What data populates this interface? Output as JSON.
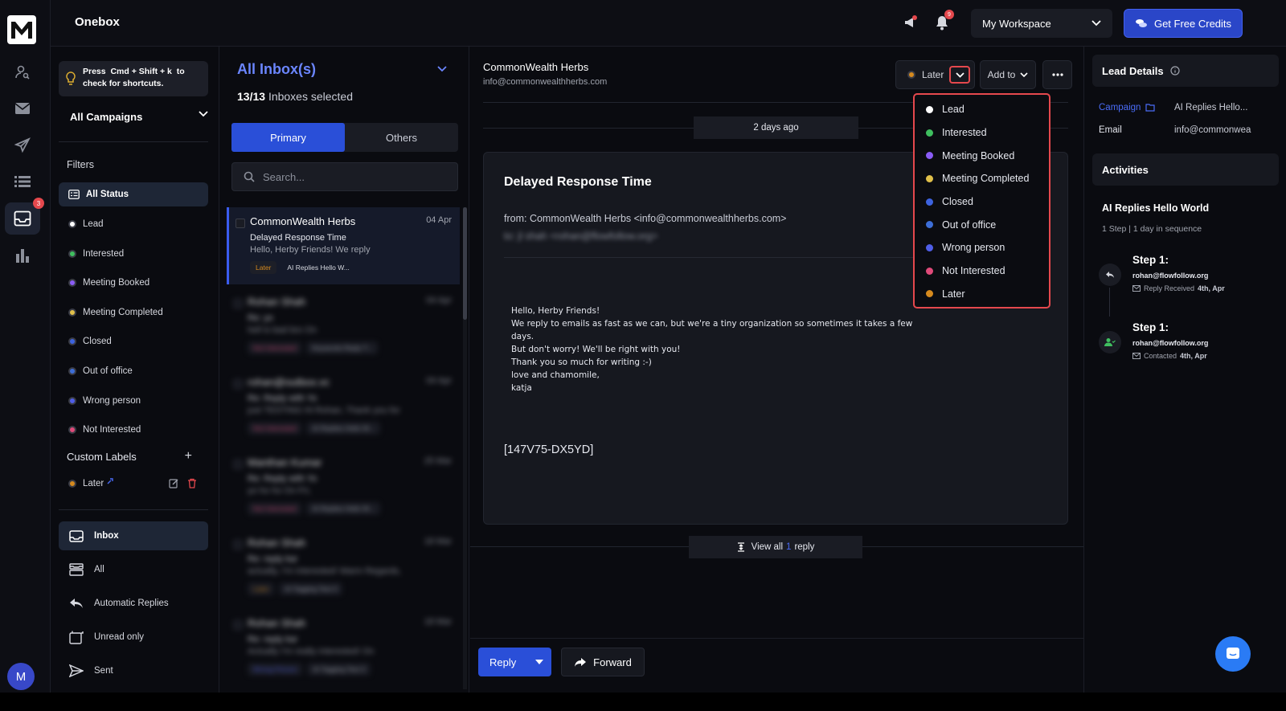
{
  "header": {
    "title": "Onebox",
    "bell_count": "9",
    "workspace": "My Workspace",
    "credits_label": "Get Free Credits"
  },
  "rail": {
    "inbox_badge": "3",
    "avatar_letter": "M"
  },
  "sidebar": {
    "tip_prefix": "Press",
    "tip_keys": "Cmd + Shift + k",
    "tip_suffix": "to check for shortcuts.",
    "campaign_select": "All Campaigns",
    "filters_label": "Filters",
    "statuses": [
      {
        "label": "All Status",
        "color": ""
      },
      {
        "label": "Lead",
        "color": "#ffffff"
      },
      {
        "label": "Interested",
        "color": "#3fbf5f"
      },
      {
        "label": "Meeting Booked",
        "color": "#8a5cf6"
      },
      {
        "label": "Meeting Completed",
        "color": "#e0c04a"
      },
      {
        "label": "Closed",
        "color": "#3d63e0"
      },
      {
        "label": "Out of office",
        "color": "#3d6ed8"
      },
      {
        "label": "Wrong person",
        "color": "#4f5ee8"
      },
      {
        "label": "Not Interested",
        "color": "#e04a7a"
      }
    ],
    "custom_labels_heading": "Custom Labels",
    "custom_label": {
      "label": "Later",
      "color": "#d68a1e"
    },
    "nav": [
      {
        "label": "Inbox"
      },
      {
        "label": "All"
      },
      {
        "label": "Automatic Replies"
      },
      {
        "label": "Unread only"
      },
      {
        "label": "Sent"
      }
    ]
  },
  "inbox": {
    "title": "All Inbox(s)",
    "count": "13/13",
    "count_suffix": "Inboxes selected",
    "tabs": [
      "Primary",
      "Others"
    ],
    "search_placeholder": "Search...",
    "mails": [
      {
        "sender": "CommonWealth Herbs",
        "date": "04 Apr",
        "subject": "Delayed Response Time",
        "preview": "Hello, Herby Friends! We reply",
        "tag1": "Later",
        "tag2": "AI Replies Hello W..."
      },
      {
        "sender": "Rohan Shah",
        "date": "04 Apr",
        "subject": "Re: yo",
        "preview": "hell is bad bro On",
        "tag1": "Not Interested",
        "tag2": "Keywords Reply T..."
      },
      {
        "sender": "rohan@outbox.vc",
        "date": "04 Apr",
        "subject": "Re: Reply with Yo",
        "preview": "just TESTING Hi Rohan, Thank you for",
        "tag1": "Not Interested",
        "tag2": "AI Replies Hello W..."
      },
      {
        "sender": "Manthan Kumar",
        "date": "25 Mar",
        "subject": "Re: Reply with Yo",
        "preview": "yo ho ho On Fri,",
        "tag1": "Not Interested",
        "tag2": "AI Replies Hello W..."
      },
      {
        "sender": "Rohan Shah",
        "date": "18 Mar",
        "subject": "Re: reply kar",
        "preview": "actually, I'm interested! Warm Regards,",
        "tag1": "Later",
        "tag2": "AI Tagging Test 3"
      },
      {
        "sender": "Rohan Shah",
        "date": "18 Mar",
        "subject": "Re: reply kar",
        "preview": "Actually I'm really interested! On",
        "tag1": "Wrong Person",
        "tag2": "AI Tagging Test 3"
      }
    ]
  },
  "email": {
    "sender_name": "CommonWealth Herbs",
    "sender_email": "info@commonwealthherbs.com",
    "status": "Later",
    "add_to": "Add to",
    "date_chip": "2 days ago",
    "subject": "Delayed Response Time",
    "time_fragment": "am",
    "forward_fragment": "ard",
    "from": "from: CommonWealth Herbs <info@commonwealthherbs.com>",
    "to": "to: jl shah <rohan@flowfollow.org>",
    "body": [
      "Hello, Herby Friends!",
      "We reply to emails as fast as we can, but we're a tiny organization so sometimes it takes a few days.",
      "But don't worry! We'll be right with you!",
      "Thank you so much for writing :-)",
      "love and chamomile,",
      "katja"
    ],
    "code": "[147V75-DX5YD]",
    "view_all_prefix": "View all",
    "view_all_count": "1",
    "view_all_suffix": "reply",
    "reply_label": "Reply",
    "forward_label": "Forward"
  },
  "dropdown": [
    {
      "label": "Lead",
      "color": "#ffffff"
    },
    {
      "label": "Interested",
      "color": "#3fbf5f"
    },
    {
      "label": "Meeting Booked",
      "color": "#8a5cf6"
    },
    {
      "label": "Meeting Completed",
      "color": "#e0c04a"
    },
    {
      "label": "Closed",
      "color": "#3d63e0"
    },
    {
      "label": "Out of office",
      "color": "#3d6ed8"
    },
    {
      "label": "Wrong person",
      "color": "#4f5ee8"
    },
    {
      "label": "Not Interested",
      "color": "#e04a7a"
    },
    {
      "label": "Later",
      "color": "#d68a1e"
    }
  ],
  "lead": {
    "title": "Lead Details",
    "campaign_key": "Campaign",
    "campaign_value": "AI Replies Hello...",
    "email_key": "Email",
    "email_value": "info@commonwea",
    "activities_title": "Activities",
    "sequence_name": "AI Replies Hello World",
    "sequence_meta": "1 Step | 1 day in sequence",
    "steps": [
      {
        "title": "Step 1:",
        "email": "rohan@flowfollow.org",
        "action": "Reply Received",
        "date": "4th, Apr"
      },
      {
        "title": "Step 1:",
        "email": "rohan@flowfollow.org",
        "action": "Contacted",
        "date": "4th, Apr"
      }
    ]
  }
}
